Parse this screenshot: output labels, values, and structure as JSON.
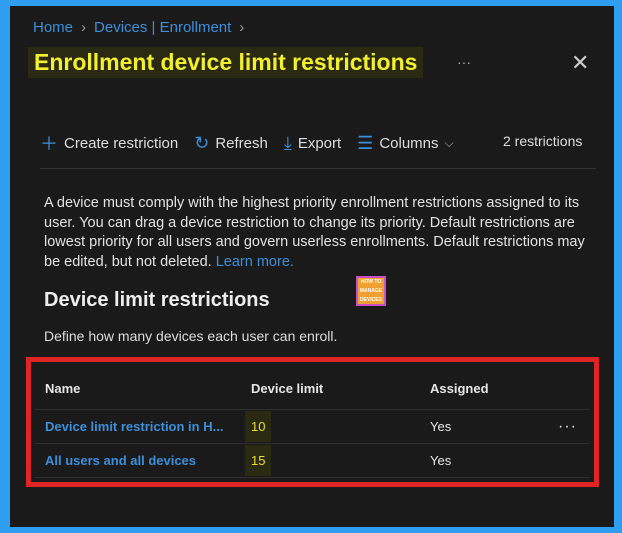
{
  "breadcrumb": [
    "Home",
    "Devices | Enrollment"
  ],
  "title": "Enrollment device limit restrictions",
  "more": "···",
  "close": "✕",
  "toolbar": {
    "create": "Create restriction",
    "refresh": "Refresh",
    "export": "Export",
    "columns": "Columns",
    "count": "2 restrictions"
  },
  "description": "A device must comply with the highest priority enrollment restrictions assigned to its user. You can drag a device restriction to change its priority. Default restrictions are lowest priority for all users and govern userless enrollments. Default restrictions may be edited, but not deleted.",
  "learn_more": "Learn more.",
  "logo_text": "HOW TO MANAGE DEVICES",
  "section": {
    "title": "Device limit restrictions",
    "subtitle": "Define how many devices each user can enroll."
  },
  "table": {
    "headers": [
      "Name",
      "Device limit",
      "Assigned"
    ],
    "rows": [
      {
        "name": "Device limit restriction in H...",
        "limit": "10",
        "assigned": "Yes",
        "menu": "···"
      },
      {
        "name": "All users and all devices",
        "limit": "15",
        "assigned": "Yes"
      }
    ]
  },
  "colors": {
    "accent": "#3d8fd9",
    "highlight": "#f3ef2e",
    "frame": "#e02424"
  }
}
